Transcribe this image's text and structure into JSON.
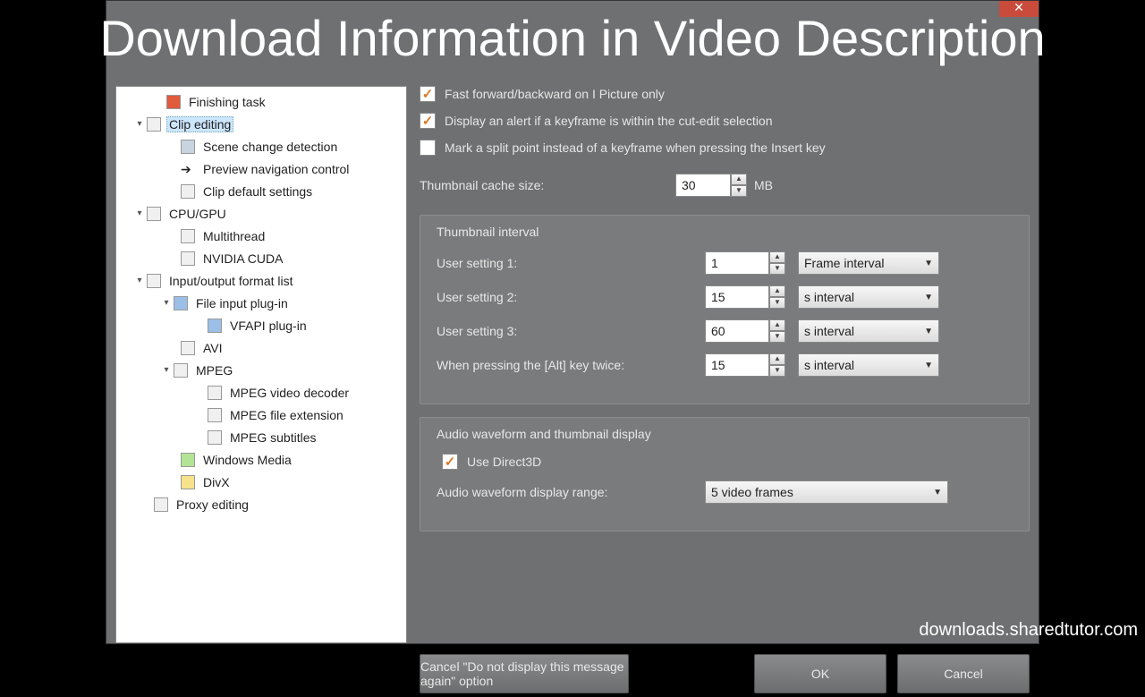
{
  "banner": "Download Information in Video Description",
  "footer_url": "downloads.sharedtutor.com",
  "close_glyph": "✕",
  "tree": [
    {
      "label": "Finishing task",
      "indent": 42,
      "toggle": "",
      "icon": "red"
    },
    {
      "label": "Clip editing",
      "indent": 20,
      "toggle": "▾",
      "icon": "doc",
      "selected": true
    },
    {
      "label": "Scene change detection",
      "indent": 58,
      "toggle": "",
      "icon": "film"
    },
    {
      "label": "Preview navigation control",
      "indent": 58,
      "toggle": "",
      "icon": "arrow"
    },
    {
      "label": "Clip default settings",
      "indent": 58,
      "toggle": "",
      "icon": "doc"
    },
    {
      "label": "CPU/GPU",
      "indent": 20,
      "toggle": "▾",
      "icon": "doc"
    },
    {
      "label": "Multithread",
      "indent": 58,
      "toggle": "",
      "icon": "doc"
    },
    {
      "label": "NVIDIA CUDA",
      "indent": 58,
      "toggle": "",
      "icon": "doc"
    },
    {
      "label": "Input/output format list",
      "indent": 20,
      "toggle": "▾",
      "icon": "doc"
    },
    {
      "label": "File input plug-in",
      "indent": 50,
      "toggle": "▾",
      "icon": "blue"
    },
    {
      "label": "VFAPI plug-in",
      "indent": 88,
      "toggle": "",
      "icon": "blue"
    },
    {
      "label": "AVI",
      "indent": 58,
      "toggle": "",
      "icon": "doc"
    },
    {
      "label": "MPEG",
      "indent": 50,
      "toggle": "▾",
      "icon": "doc"
    },
    {
      "label": "MPEG video decoder",
      "indent": 88,
      "toggle": "",
      "icon": "doc"
    },
    {
      "label": "MPEG file extension",
      "indent": 88,
      "toggle": "",
      "icon": "doc"
    },
    {
      "label": "MPEG subtitles",
      "indent": 88,
      "toggle": "",
      "icon": "doc"
    },
    {
      "label": "Windows Media",
      "indent": 58,
      "toggle": "",
      "icon": "green"
    },
    {
      "label": "DivX",
      "indent": 58,
      "toggle": "",
      "icon": "yellow"
    },
    {
      "label": "Proxy editing",
      "indent": 28,
      "toggle": "",
      "icon": "doc"
    }
  ],
  "checks": {
    "c1": {
      "label": "Fast forward/backward on I Picture only",
      "checked": true
    },
    "c2": {
      "label": "Display an alert if a keyframe is within the cut-edit selection",
      "checked": true
    },
    "c3": {
      "label": "Mark a split point instead of a keyframe when pressing the Insert key",
      "checked": false
    }
  },
  "cache": {
    "label": "Thumbnail cache size:",
    "value": "30",
    "unit": "MB"
  },
  "group1": {
    "title": "Thumbnail interval",
    "rows": [
      {
        "lbl": "User setting 1:",
        "val": "1",
        "combo": "Frame interval"
      },
      {
        "lbl": "User setting 2:",
        "val": "15",
        "combo": "s interval"
      },
      {
        "lbl": "User setting 3:",
        "val": "60",
        "combo": "s interval"
      },
      {
        "lbl": "When pressing the [Alt] key twice:",
        "val": "15",
        "combo": "s interval"
      }
    ]
  },
  "group2": {
    "title": "Audio waveform and thumbnail display",
    "use_d3d": {
      "label": "Use Direct3D",
      "checked": true
    },
    "range_label": "Audio waveform display range:",
    "range_value": "5 video frames"
  },
  "buttons": {
    "cancel_msg": "Cancel \"Do not display this message again\" option",
    "ok": "OK",
    "cancel": "Cancel"
  }
}
